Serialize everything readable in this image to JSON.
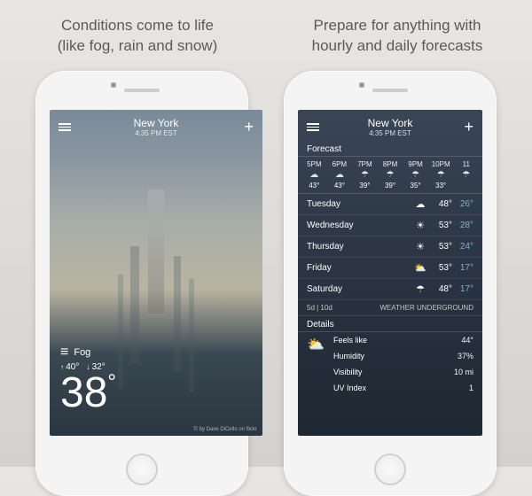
{
  "captions": {
    "left_l1": "Conditions come to life",
    "left_l2": "(like fog, rain and snow)",
    "right_l1": "Prepare for anything with",
    "right_l2": "hourly and daily forecasts"
  },
  "header": {
    "city": "New York",
    "time": "4:35 PM EST"
  },
  "current": {
    "condition": "Fog",
    "high": "40°",
    "low": "32°",
    "temp": "38",
    "credit": "© by Dave DiCello on flickr"
  },
  "forecast_title": "Forecast",
  "hourly": [
    {
      "time": "5PM",
      "icon": "☁",
      "hi": "43°",
      "lo": ""
    },
    {
      "time": "6PM",
      "icon": "☁",
      "hi": "43°",
      "lo": ""
    },
    {
      "time": "7PM",
      "icon": "☂",
      "hi": "39°",
      "lo": ""
    },
    {
      "time": "8PM",
      "icon": "☂",
      "hi": "39°",
      "lo": ""
    },
    {
      "time": "9PM",
      "icon": "☂",
      "hi": "35°",
      "lo": ""
    },
    {
      "time": "10PM",
      "icon": "☂",
      "hi": "33°",
      "lo": ""
    },
    {
      "time": "11",
      "icon": "☂",
      "hi": "",
      "lo": ""
    }
  ],
  "daily": [
    {
      "day": "Tuesday",
      "icon": "☁",
      "hi": "48°",
      "lo": "26°"
    },
    {
      "day": "Wednesday",
      "icon": "☀",
      "hi": "53°",
      "lo": "28°"
    },
    {
      "day": "Thursday",
      "icon": "☀",
      "hi": "53°",
      "lo": "24°"
    },
    {
      "day": "Friday",
      "icon": "⛅",
      "hi": "53°",
      "lo": "17°"
    },
    {
      "day": "Saturday",
      "icon": "☂",
      "hi": "48°",
      "lo": "17°"
    }
  ],
  "toggle": {
    "left": "5d | 10d",
    "right": "WEATHER UNDERGROUND"
  },
  "details_title": "Details",
  "details": [
    {
      "label": "Feels like",
      "value": "44°"
    },
    {
      "label": "Humidity",
      "value": "37%"
    },
    {
      "label": "Visibility",
      "value": "10 mi"
    },
    {
      "label": "UV Index",
      "value": "1"
    }
  ],
  "icons": {
    "fog": "≡",
    "details": "⛅"
  }
}
